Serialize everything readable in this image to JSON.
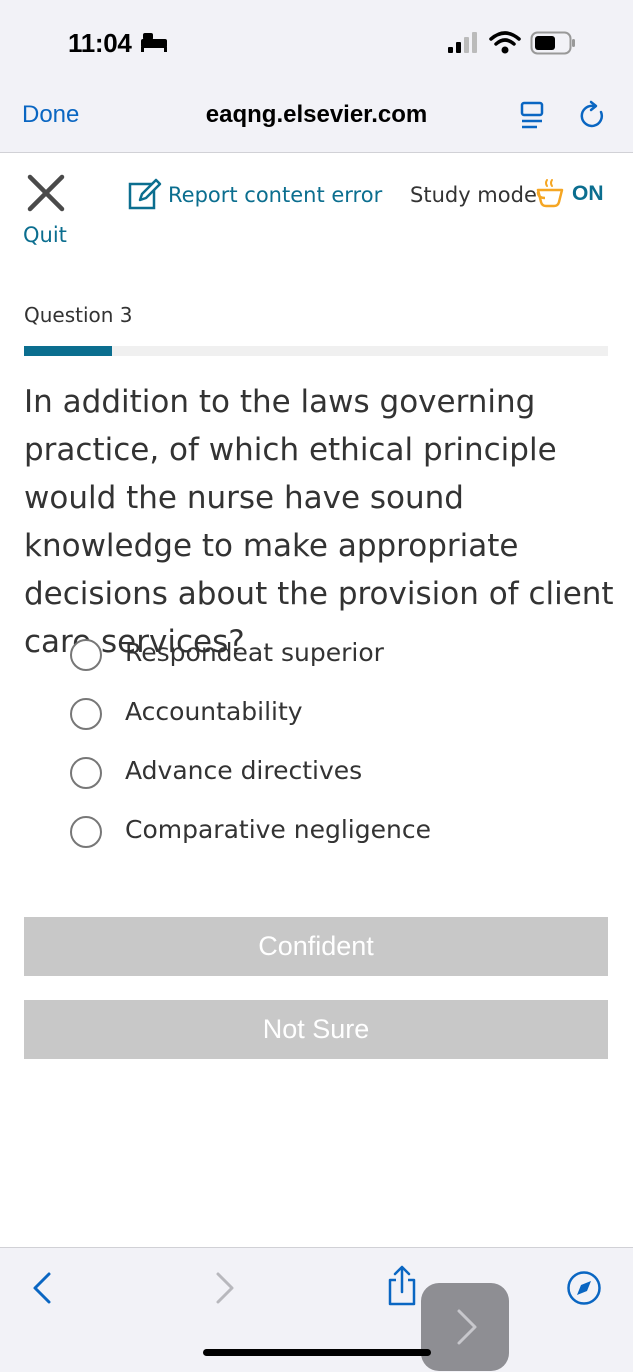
{
  "status_bar": {
    "time": "11:04",
    "icons": [
      "bed-icon",
      "cellular-signal-icon",
      "wifi-icon",
      "battery-icon"
    ]
  },
  "browser": {
    "done_label": "Done",
    "url": "eaqng.elsevier.com",
    "toolbar_icons": [
      "reader-icon",
      "reload-icon"
    ]
  },
  "quiz_header": {
    "quit_label": "Quit",
    "report_label": "Report content error",
    "study_mode_label": "Study mode",
    "study_mode_state": "ON"
  },
  "question": {
    "number_label": "Question 3",
    "progress_fraction": 0.15,
    "text": "In addition to the laws governing practice, of which ethical principle would the nurse have sound knowledge to make appropriate decisions about the provision of client care services?",
    "options": [
      {
        "label": "Respondeat superior",
        "selected": false
      },
      {
        "label": "Accountability",
        "selected": false
      },
      {
        "label": "Advance directives",
        "selected": false
      },
      {
        "label": "Comparative negligence",
        "selected": false
      }
    ]
  },
  "confidence_buttons": {
    "confident_label": "Confident",
    "not_sure_label": "Not Sure"
  },
  "bottom_toolbar": {
    "icons": [
      "back-icon",
      "forward-icon",
      "share-icon",
      "compass-icon",
      "next-icon"
    ]
  },
  "colors": {
    "accent": "#0b6e8f",
    "ios_link": "#0a66c2",
    "button_disabled": "#c8c8c8",
    "coffee": "#f5a623"
  }
}
